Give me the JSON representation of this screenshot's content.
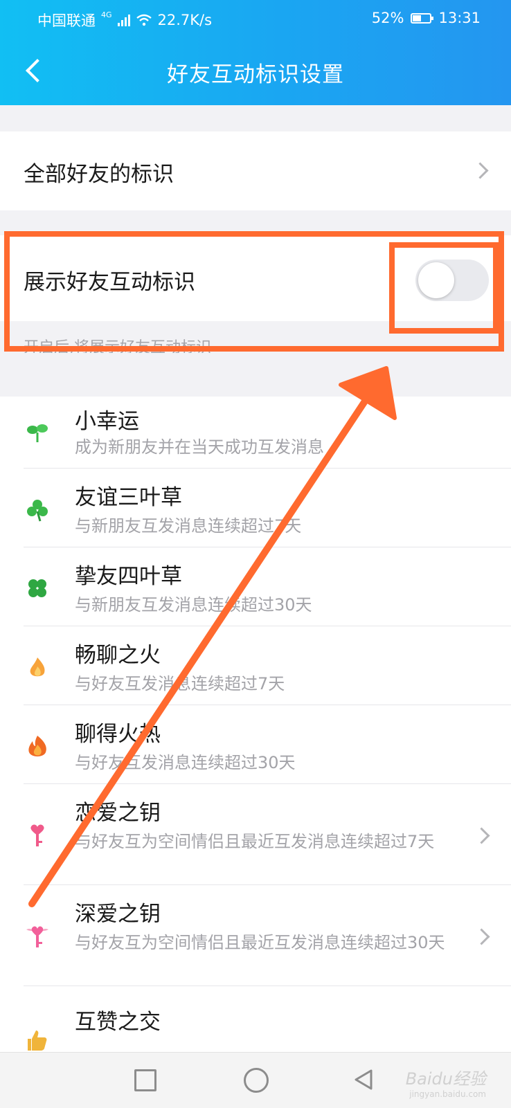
{
  "status_bar": {
    "carrier": "中国联通",
    "network_badge": "4G",
    "speed": "22.7K/s",
    "battery_percent": "52%",
    "battery_level": 0.52,
    "time": "13:31"
  },
  "header": {
    "title": "好友互动标识设置",
    "back_icon": "chevron-left-icon"
  },
  "all_friends": {
    "label": "全部好友的标识"
  },
  "show_setting": {
    "label": "展示好友互动标识",
    "toggle_on": false,
    "hint": "开启后,将展示好友互动标识"
  },
  "badges": [
    {
      "name": "小幸运",
      "desc": "成为新朋友并在当天成功互发消息",
      "icon": "sprout-icon",
      "color": "#3bb84a",
      "has_chevron": false
    },
    {
      "name": "友谊三叶草",
      "desc": "与新朋友互发消息连续超过7天",
      "icon": "three-leaf-clover-icon",
      "color": "#3bb84a",
      "has_chevron": false
    },
    {
      "name": "挚友四叶草",
      "desc": "与新朋友互发消息连续超过30天",
      "icon": "four-leaf-clover-icon",
      "color": "#2fa742",
      "has_chevron": false
    },
    {
      "name": "畅聊之火",
      "desc": "与好友互发消息连续超过7天",
      "icon": "small-flame-icon",
      "color": "#f7a33a",
      "has_chevron": false
    },
    {
      "name": "聊得火热",
      "desc": "与好友互发消息连续超过30天",
      "icon": "big-flame-icon",
      "color": "#f06a23",
      "has_chevron": false
    },
    {
      "name": "恋爱之钥",
      "desc": "与好友互为空间情侣且最近互发消息连续超过7天",
      "icon": "heart-key-icon",
      "color": "#f05a8a",
      "has_chevron": true
    },
    {
      "name": "深爱之钥",
      "desc": "与好友互为空间情侣且最近互发消息连续超过30天",
      "icon": "winged-heart-key-icon",
      "color": "#f2609a",
      "has_chevron": true
    },
    {
      "name": "互赞之交",
      "desc": "",
      "icon": "thumb-up-icon",
      "color": "#f0b43a",
      "has_chevron": false
    }
  ],
  "watermark": {
    "text": "Baidu经验",
    "sub": "jingyan.baidu.com"
  },
  "colors": {
    "header_start": "#11bff3",
    "header_end": "#2496f0",
    "annotation": "#ff6a2f"
  }
}
